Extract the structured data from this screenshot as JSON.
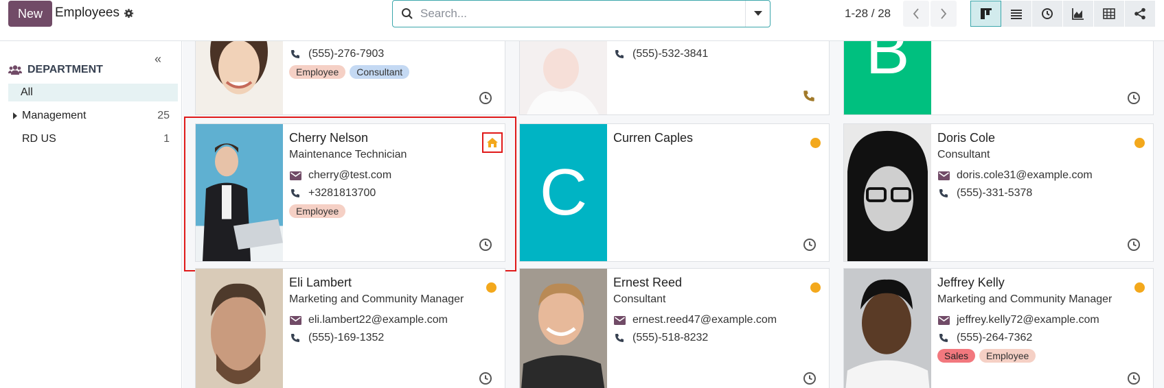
{
  "topbar": {
    "new_label": "New",
    "title": "Employees",
    "search_placeholder": "Search...",
    "pager": "1-28 / 28"
  },
  "sidebar": {
    "heading": "DEPARTMENT",
    "items": [
      {
        "label": "All",
        "count": "",
        "selected": true
      },
      {
        "label": "Management",
        "count": "25",
        "expandable": true
      },
      {
        "label": "RD US",
        "count": "1"
      }
    ]
  },
  "cards": [
    {
      "name": "",
      "job": "",
      "phone": "(555)-276-7903",
      "tags": [
        "Employee",
        "Consultant"
      ]
    },
    {
      "name": "",
      "job": "",
      "phone": "(555)-532-3841",
      "tags": []
    },
    {
      "name": "",
      "job": "",
      "letter": "B",
      "tags": []
    },
    {
      "name": "Cherry Nelson",
      "job": "Maintenance Technician",
      "email": "cherry@test.com",
      "phone": "+3281813700",
      "tags": [
        "Employee"
      ]
    },
    {
      "name": "Curren Caples",
      "letter": "C"
    },
    {
      "name": "Doris Cole",
      "job": "Consultant",
      "email": "doris.cole31@example.com",
      "phone": "(555)-331-5378"
    },
    {
      "name": "Eli Lambert",
      "job": "Marketing and Community Manager",
      "email": "eli.lambert22@example.com",
      "phone": "(555)-169-1352"
    },
    {
      "name": "Ernest Reed",
      "job": "Consultant",
      "email": "ernest.reed47@example.com",
      "phone": "(555)-518-8232"
    },
    {
      "name": "Jeffrey Kelly",
      "job": "Marketing and Community Manager",
      "email": "jeffrey.kelly72@example.com",
      "phone": "(555)-264-7362",
      "tags": [
        "Sales",
        "Employee"
      ]
    }
  ],
  "colors": {
    "brand": "#714b67",
    "status": "#f3a81c",
    "letter_b": "#00c07f",
    "letter_c": "#00b4c4",
    "highlight": "#e01818"
  }
}
